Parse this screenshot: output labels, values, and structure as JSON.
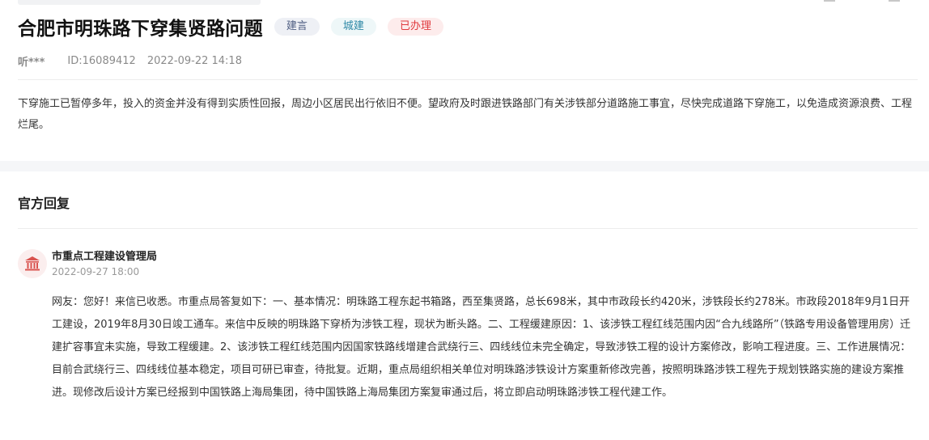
{
  "issue": {
    "title": "合肥市明珠路下穿集贤路问题",
    "tags": {
      "category": "建言",
      "domain": "城建",
      "status": "已办理"
    },
    "user": "听***",
    "id_text": "ID:16089412",
    "datetime": "2022-09-22 14:18",
    "content": "下穿施工已暂停多年，投入的资金并没有得到实质性回报，周边小区居民出行依旧不便。望政府及时跟进铁路部门有关涉铁部分道路施工事宜，尽快完成道路下穿施工，以免造成资源浪费、工程烂尾。"
  },
  "reply": {
    "section_title": "官方回复",
    "department": "市重点工程建设管理局",
    "datetime": "2022-09-27 18:00",
    "content": "网友：您好！来信已收悉。市重点局答复如下：一、基本情况：明珠路工程东起书箱路，西至集贤路，总长698米，其中市政段长约420米，涉铁段长约278米。市政段2018年9月1日开工建设，2019年8月30日竣工通车。来信中反映的明珠路下穿桥为涉铁工程，现状为断头路。二、工程缓建原因：1、该涉铁工程红线范围内因“合九线路所”（铁路专用设备管理用房）迁建扩容事宜未实施，导致工程缓建。2、该涉铁工程红线范围内因国家铁路线增建合武绕行三、四线线位未完全确定，导致涉铁工程的设计方案修改，影响工程进度。三、工作进展情况：目前合武绕行三、四线线位基本稳定，项目可研已审查，待批复。近期，重点局组织相关单位对明珠路涉铁设计方案重新修改完善，按照明珠路涉铁工程先于规划铁路实施的建设方案推进。现修改后设计方案已经报到中国铁路上海局集团，待中国铁路上海局集团方案复审通过后，将立即启动明珠路涉铁工程代建工作。"
  },
  "icons": {
    "avatar": "government-building-icon"
  },
  "colors": {
    "tag_suggest_bg": "#eef0f5",
    "tag_city_bg": "#eef7f8",
    "tag_done_bg": "#fdecec",
    "tag_done_text": "#e03a3e",
    "avatar_icon": "#d9534f"
  }
}
